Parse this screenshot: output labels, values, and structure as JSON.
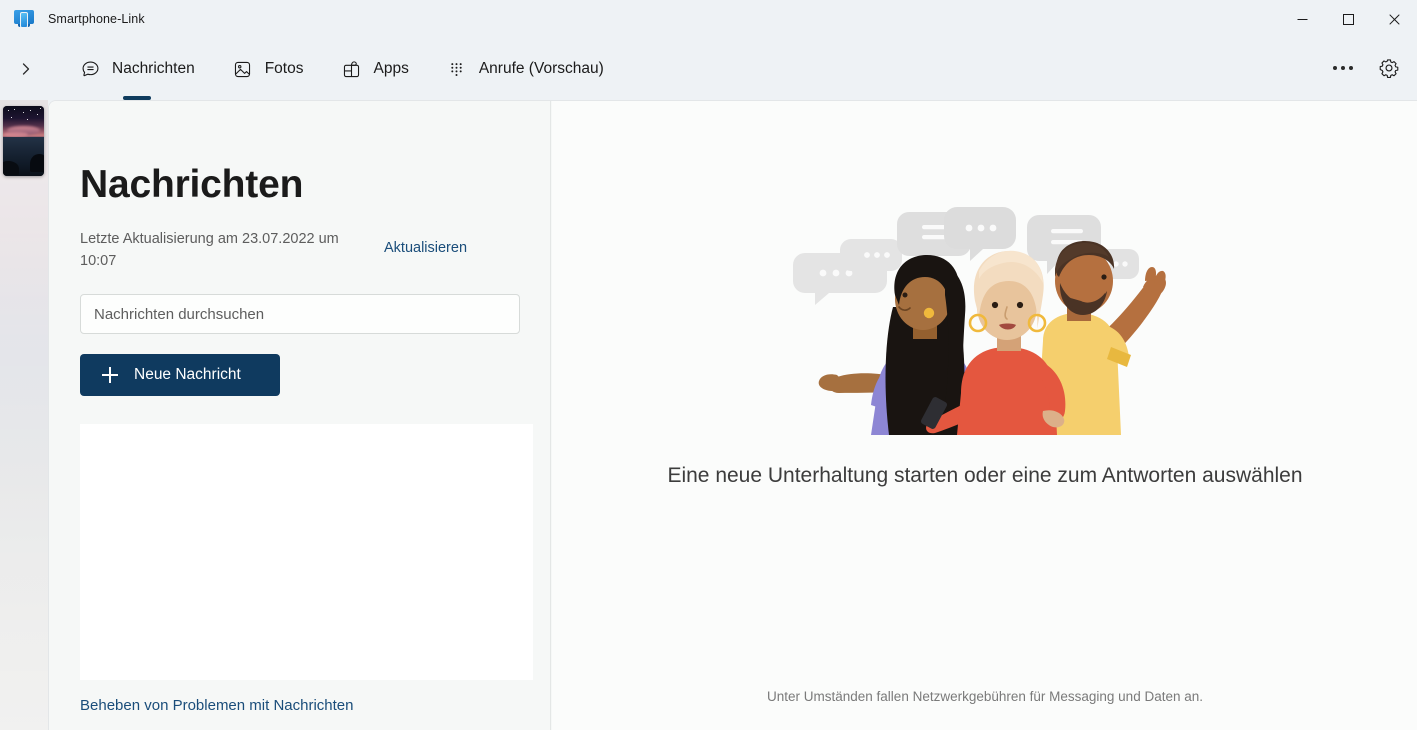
{
  "window": {
    "title": "Smartphone-Link",
    "app_icon": "phone-link-icon",
    "controls": {
      "minimize": "minimize-icon",
      "maximize": "maximize-icon",
      "close": "close-icon"
    }
  },
  "nav": {
    "expand_icon": "chevron-right-icon",
    "tabs": [
      {
        "label": "Nachrichten",
        "icon": "chat-bubble-icon",
        "active": true
      },
      {
        "label": "Fotos",
        "icon": "photo-icon",
        "active": false
      },
      {
        "label": "Apps",
        "icon": "apps-grid-icon",
        "active": false
      },
      {
        "label": "Anrufe (Vorschau)",
        "icon": "dialpad-icon",
        "active": false
      }
    ],
    "more_icon": "ellipsis-icon",
    "settings_icon": "gear-icon"
  },
  "rail": {
    "phone_thumb": "phone-preview-thumbnail"
  },
  "left_panel": {
    "title": "Nachrichten",
    "last_update": "Letzte Aktualisierung am 23.07.2022 um 10:07",
    "refresh_label": "Aktualisieren",
    "search": {
      "placeholder": "Nachrichten durchsuchen",
      "value": ""
    },
    "new_message_label": "Neue Nachricht",
    "troubleshoot_label": "Beheben von Problemen mit Nachrichten"
  },
  "right_panel": {
    "empty_state_text": "Eine neue Unterhaltung starten oder eine zum Antworten auswählen",
    "footer_note": "Unter Umständen fallen Netzwerkgebühren für Messaging und Daten an.",
    "illustration": "three-people-chatting-illustration"
  },
  "colors": {
    "accent_button": "#0f3a5f",
    "link": "#1a4d7a",
    "tab_indicator": "#0f3c5e",
    "titlebar_bg": "#eef2f5",
    "panel_bg": "#f6f8f7",
    "right_bg": "#fbfcfb"
  }
}
